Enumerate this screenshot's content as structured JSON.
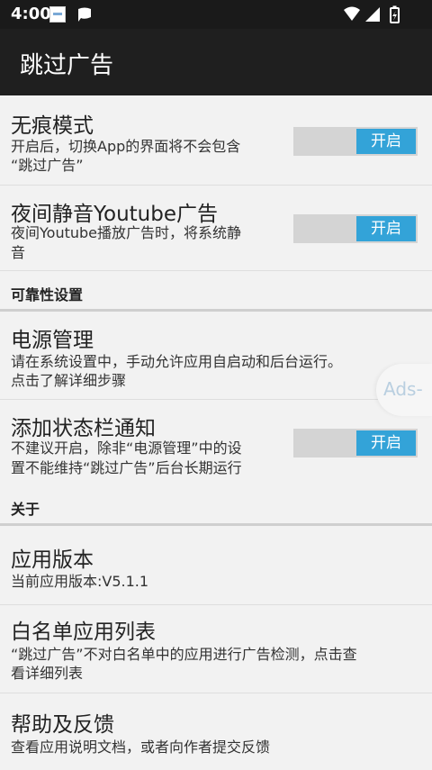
{
  "status_bar": {
    "time": "4:00",
    "notif_icons": [
      "doc-icon",
      "chat-icon"
    ],
    "right_icons": [
      "wifi-icon",
      "signal-icon",
      "battery-icon"
    ]
  },
  "app_bar": {
    "title": "跳过广告"
  },
  "prefs": {
    "incognito": {
      "title": "无痕模式",
      "summary_l1": "开启后，切换App的界面将不会包含",
      "summary_l2": "“跳过广告”",
      "switch_label": "开启"
    },
    "night_mute": {
      "title": "夜间静音Youtube广告",
      "summary_l1": "夜间Youtube播放广告时，将系统静",
      "summary_l2": "音",
      "switch_label": "开启"
    }
  },
  "reliability": {
    "header": "可靠性设置",
    "power": {
      "title": "电源管理",
      "summary_l1": "请在系统设置中，手动允许应用自启动和后台运行。",
      "summary_l2": "点击了解详细步骤"
    },
    "notify": {
      "title": "添加状态栏通知",
      "summary_l1": "不建议开启，除非“电源管理”中的设",
      "summary_l2": "置不能维持“跳过广告”后台长期运行",
      "switch_label": "开启"
    }
  },
  "about": {
    "header": "关于",
    "version": {
      "title": "应用版本",
      "summary": "当前应用版本:V5.1.1"
    },
    "whitelist": {
      "title": "白名单应用列表",
      "summary_l1": "“跳过广告”不对白名单中的应用进行广告检测，点击查",
      "summary_l2": "看详细列表"
    },
    "help": {
      "title": "帮助及反馈",
      "summary": "查看应用说明文档，或者向作者提交反馈"
    }
  },
  "floating": {
    "label": "Ads-"
  },
  "colors": {
    "accent": "#33a3d8",
    "toolbar": "#1f1f1f",
    "statusbar": "#1a1a1a"
  }
}
